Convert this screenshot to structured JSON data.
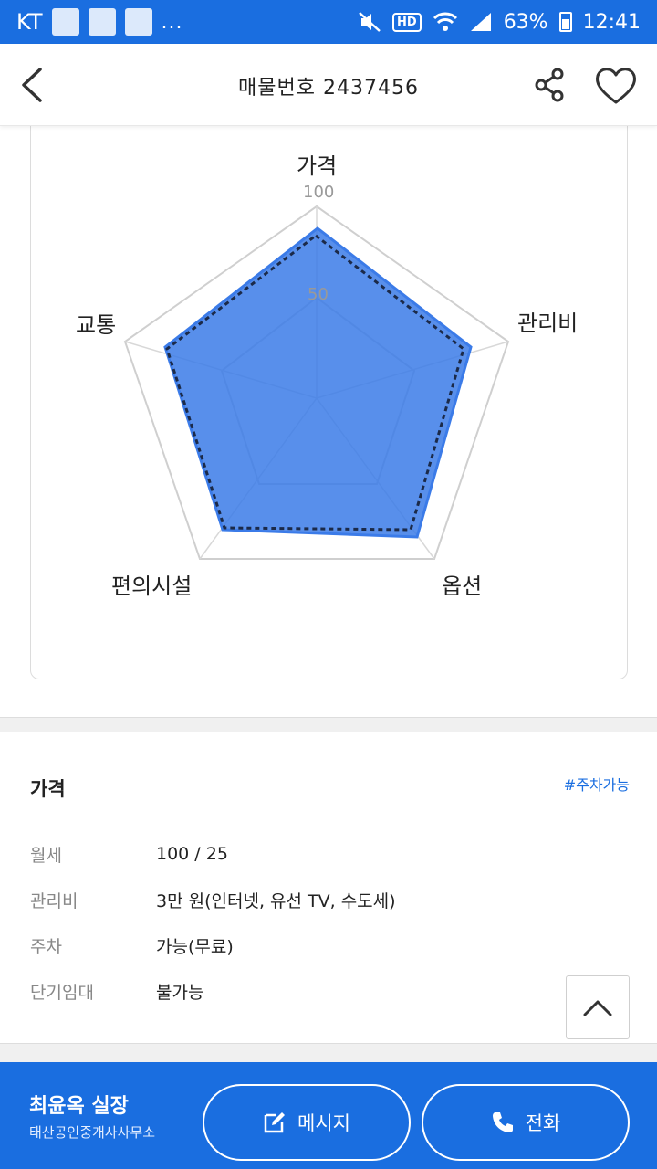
{
  "status_bar": {
    "carrier": "KT",
    "more": "...",
    "hd": "HD",
    "battery": "63%",
    "time": "12:41"
  },
  "header": {
    "title": "매물번호 2437456"
  },
  "radar": {
    "axes": [
      "가격",
      "관리비",
      "옵션",
      "편의시설",
      "교통"
    ],
    "ticks": [
      "100",
      "50"
    ],
    "fill_color": "#3b7be8"
  },
  "price_section": {
    "title": "가격",
    "tag": "#주차가능",
    "rows": [
      {
        "label": "월세",
        "value": "100 / 25"
      },
      {
        "label": "관리비",
        "value": "3만 원(인터넷, 유선 TV, 수도세)"
      },
      {
        "label": "주차",
        "value": "가능(무료)"
      },
      {
        "label": "단기임대",
        "value": "불가능"
      }
    ]
  },
  "bottom_bar": {
    "agent_name": "최윤옥 실장",
    "agent_office": "태산공인중개사사무소",
    "message_label": "메시지",
    "call_label": "전화"
  },
  "colors": {
    "primary": "#1a6ee0",
    "band": "#f0f0f0"
  }
}
